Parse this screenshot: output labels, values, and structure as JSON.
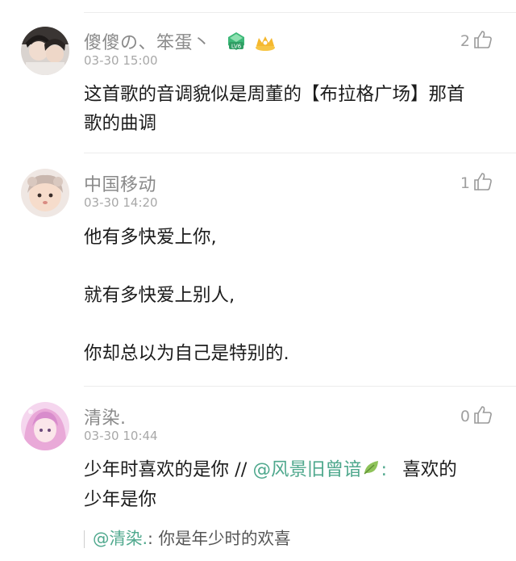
{
  "comments": [
    {
      "username": "傻傻の、笨蛋丶",
      "level_badge": "LV6",
      "timestamp": "03-30 15:00",
      "like_count": "2",
      "content_lines": [
        "这首歌的音调貌似是周董的【布拉格广场】那首",
        "歌的曲调"
      ]
    },
    {
      "username": "中国移动",
      "timestamp": "03-30 14:20",
      "like_count": "1",
      "content_lines": [
        "他有多快爱上你,",
        "就有多快爱上别人,",
        "你却总以为自己是特别的."
      ]
    },
    {
      "username": "清染.",
      "timestamp": "03-30 10:44",
      "like_count": "0",
      "content_line1_text": "少年时喜欢的是你 //",
      "content_line1_mention": "@风景旧曾谙",
      "content_line1_colon": ":",
      "content_line1_rest": "喜欢的",
      "content_line2": "少年是你",
      "reply_mention": "@清染.",
      "reply_text": ": 你是年少时的欢喜"
    }
  ],
  "icons": {
    "like": "thumbs-up-icon",
    "level_badge": "diamond-level-icon",
    "vip_badge": "crown-icon",
    "leaf": "leaf-icon"
  },
  "colors": {
    "accent_green": "#4fa88d",
    "username_gray": "#8a8a8a",
    "text_dark": "#1c1c1c"
  }
}
